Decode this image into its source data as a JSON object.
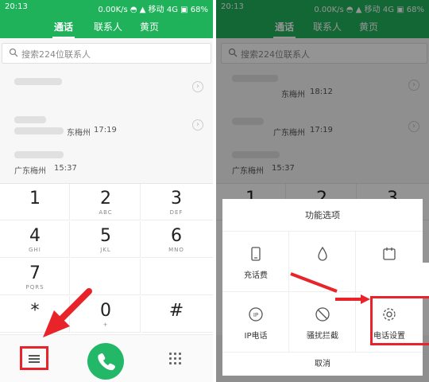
{
  "left_screen": {
    "status": {
      "time": "20:13",
      "right_text": "0.00K/s  ◓  ▲  移动 4G ▣ 68%"
    },
    "colors": {
      "accent": "#1fb25a",
      "highlight": "#e8232a"
    },
    "tabs": [
      {
        "label": "通话"
      },
      {
        "label": "联系人"
      },
      {
        "label": "黄页"
      }
    ],
    "search": {
      "placeholder": "搜索224位联系人"
    },
    "calls": [
      {
        "location": "",
        "time": ""
      },
      {
        "location": "东梅州",
        "time": "17:19"
      },
      {
        "location": "广东梅州",
        "time": "15:37"
      }
    ],
    "keypad": [
      {
        "digit": "1",
        "letters": ""
      },
      {
        "digit": "2",
        "letters": "ABC"
      },
      {
        "digit": "3",
        "letters": "DEF"
      },
      {
        "digit": "4",
        "letters": "GHI"
      },
      {
        "digit": "5",
        "letters": "JKL"
      },
      {
        "digit": "6",
        "letters": "MNO"
      },
      {
        "digit": "7",
        "letters": "PQRS"
      },
      {
        "digit": "",
        "letters": ""
      },
      {
        "digit": "",
        "letters": ""
      },
      {
        "digit": "*",
        "letters": ""
      },
      {
        "digit": "0",
        "letters": "+"
      },
      {
        "digit": "#",
        "letters": ""
      }
    ],
    "bottom": {
      "menu_icon": "hamburger-icon",
      "call_icon": "phone-icon",
      "dialpad_icon": "dialpad-icon"
    }
  },
  "right_screen": {
    "status": {
      "time": "20:13",
      "right_text": "0.00K/s  ◓  ▲  移动 4G ▣ 68%"
    },
    "tabs": [
      {
        "label": "通话"
      },
      {
        "label": "联系人"
      },
      {
        "label": "黄页"
      }
    ],
    "search": {
      "placeholder": "搜索224位联系人"
    },
    "calls": [
      {
        "location": "东梅州",
        "time": "18:12"
      },
      {
        "location": "广东梅州",
        "time": "17:19"
      },
      {
        "location": "广东梅州",
        "time": "15:37"
      }
    ],
    "keypad_partial": [
      "1",
      "2",
      "3"
    ],
    "dialog": {
      "title": "功能选项",
      "options": [
        {
          "label": "充话费",
          "icon": "phone-device-icon"
        },
        {
          "label": "",
          "icon": "water-drop-icon"
        },
        {
          "label": "",
          "icon": "calendar-icon"
        },
        {
          "label": "IP电话",
          "icon": "ip-circle-icon"
        },
        {
          "label": "骚扰拦截",
          "icon": "block-icon"
        },
        {
          "label": "电话设置",
          "icon": "settings-gear-icon"
        }
      ],
      "cancel": "取消"
    }
  }
}
